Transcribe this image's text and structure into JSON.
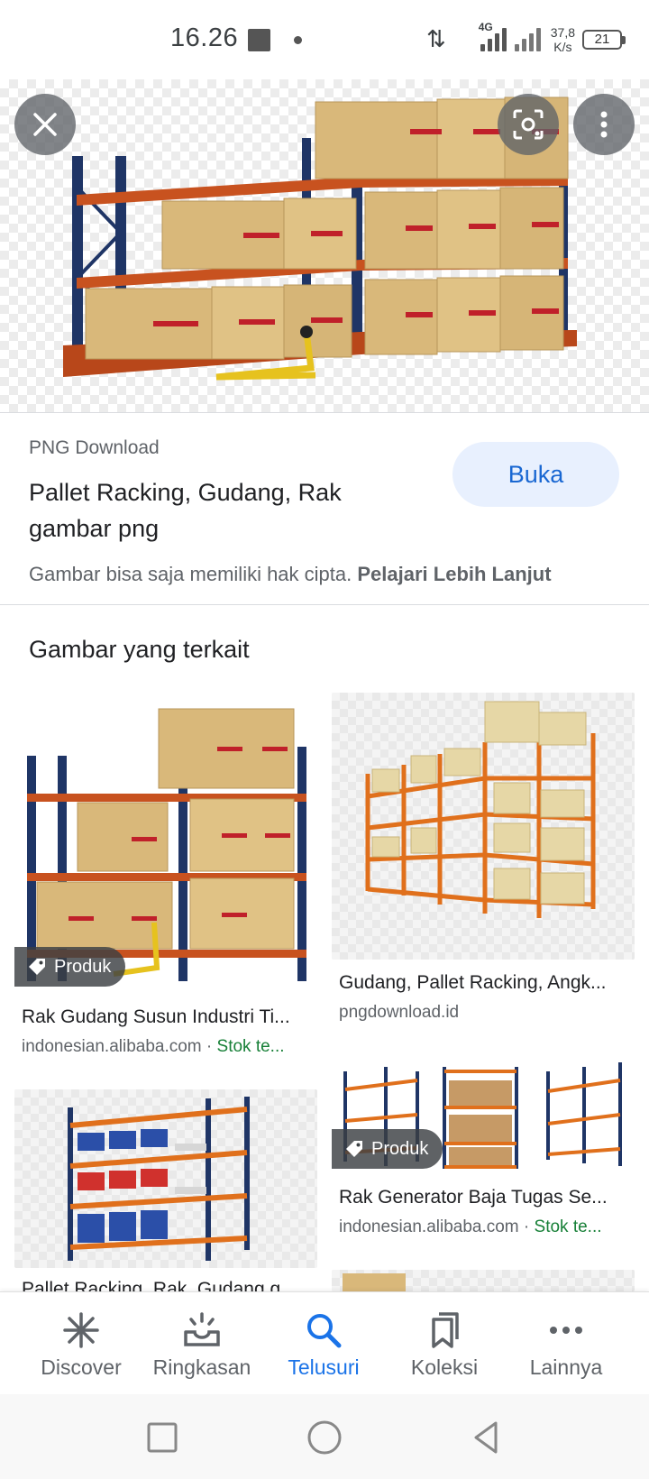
{
  "status_bar": {
    "time": "16.26",
    "network": "4G",
    "speed_value": "37,8",
    "speed_unit": "K/s",
    "battery": "21"
  },
  "viewer": {
    "source": "PNG Download",
    "title": "Pallet Racking, Gudang, Rak gambar png",
    "open_button": "Buka",
    "copyright_text": "Gambar bisa saja memiliki hak cipta.",
    "learn_more": "Pelajari Lebih Lanjut"
  },
  "related": {
    "heading": "Gambar yang terkait",
    "items": [
      {
        "badge": "Produk",
        "title": "Rak Gudang Susun Industri Ti...",
        "source": "indonesian.alibaba.com",
        "separator": " · ",
        "stock": "Stok te..."
      },
      {
        "badge": "",
        "title": "Gudang, Pallet Racking, Angk...",
        "source": "pngdownload.id",
        "separator": "",
        "stock": ""
      },
      {
        "badge": "Produk",
        "title": "Rak Generator Baja Tugas Se...",
        "source": "indonesian.alibaba.com",
        "separator": " · ",
        "stock": "Stok te..."
      },
      {
        "badge": "",
        "title": "Pallet Racking, Rak, Gudang g...",
        "source": "",
        "separator": "",
        "stock": ""
      }
    ]
  },
  "bottom_nav": {
    "items": [
      {
        "label": "Discover",
        "icon": "asterisk-icon"
      },
      {
        "label": "Ringkasan",
        "icon": "inbox-sparkle-icon"
      },
      {
        "label": "Telusuri",
        "icon": "search-icon",
        "active": true
      },
      {
        "label": "Koleksi",
        "icon": "bookmarks-icon"
      },
      {
        "label": "Lainnya",
        "icon": "more-horizontal-icon"
      }
    ]
  },
  "colors": {
    "accent": "#1a73e8",
    "buka_bg": "#e8f0fe",
    "stock_green": "#188038",
    "rack_orange": "#c8521f",
    "rack_blue": "#1f3566",
    "box_tan": "#d9b87a"
  }
}
